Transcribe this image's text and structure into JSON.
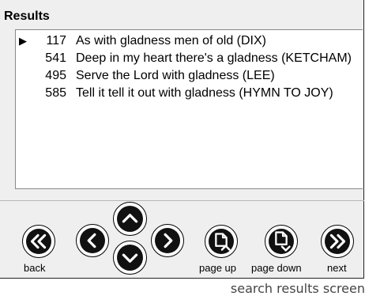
{
  "title": "Results",
  "results": [
    {
      "selected": true,
      "number": "117",
      "text": "As with gladness men of old  (DIX)"
    },
    {
      "selected": false,
      "number": "541",
      "text": "Deep in my heart there's a gladness  (KETCHAM)"
    },
    {
      "selected": false,
      "number": "495",
      "text": "Serve the Lord with gladness  (LEE)"
    },
    {
      "selected": false,
      "number": "585",
      "text": "Tell it tell it out with gladness  (HYMN TO JOY)"
    }
  ],
  "marker": "▶",
  "buttons": {
    "back": "back",
    "page_up": "page up",
    "page_down": "page down",
    "next": "next"
  },
  "caption": "search results screen"
}
